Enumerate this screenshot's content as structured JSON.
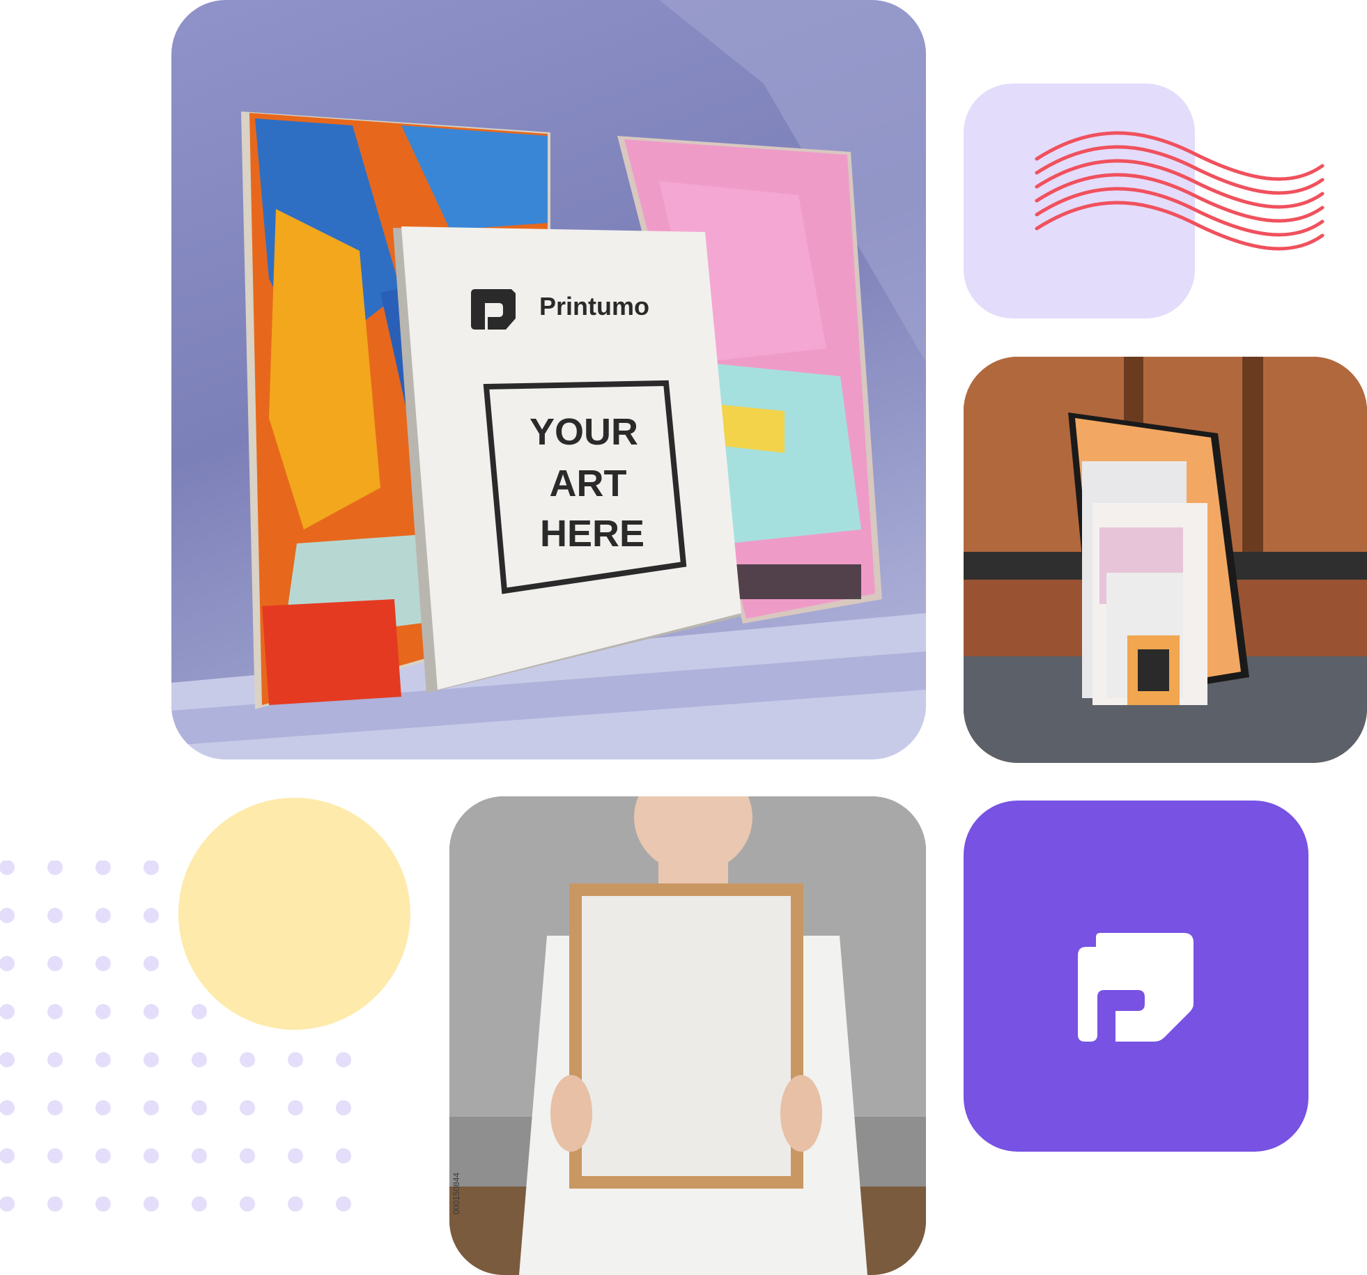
{
  "canvas_brand": {
    "logo_text": "Printumo",
    "placeholder_lines": [
      "YOUR",
      "ART",
      "HERE"
    ]
  },
  "photo_watermark": "000150844",
  "colors": {
    "stamp_bg": "#e4dcfb",
    "stamp_waves": "#f0515d",
    "sun": "#feeaab",
    "dots": "#e5defa",
    "logo_tile": "#7752e3",
    "logo_mark": "#ffffff"
  },
  "icons": {
    "brand_logo": "printumo-logo-icon"
  }
}
